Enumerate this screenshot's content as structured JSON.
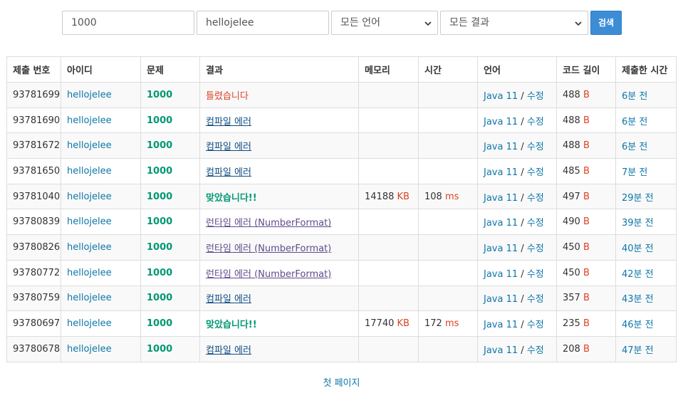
{
  "filters": {
    "problem_id": "1000",
    "user_id": "hellojelee",
    "language": "모든 언어",
    "result": "모든 결과",
    "search_label": "검색"
  },
  "table": {
    "headers": [
      "제출 번호",
      "아이디",
      "문제",
      "결과",
      "메모리",
      "시간",
      "언어",
      "코드 길이",
      "제출한 시간"
    ],
    "rows": [
      {
        "id": "93781699",
        "user": "hellojelee",
        "problem": "1000",
        "result": "틀렸습니다",
        "result_type": "wrong",
        "memory": "",
        "memory_unit": "",
        "time": "",
        "time_unit": "",
        "lang": "Java 11",
        "edit": "수정",
        "code_len": "488",
        "code_unit": "B",
        "submitted": "6분 전"
      },
      {
        "id": "93781690",
        "user": "hellojelee",
        "problem": "1000",
        "result": "컴파일 에러",
        "result_type": "ce",
        "memory": "",
        "memory_unit": "",
        "time": "",
        "time_unit": "",
        "lang": "Java 11",
        "edit": "수정",
        "code_len": "488",
        "code_unit": "B",
        "submitted": "6분 전"
      },
      {
        "id": "93781672",
        "user": "hellojelee",
        "problem": "1000",
        "result": "컴파일 에러",
        "result_type": "ce",
        "memory": "",
        "memory_unit": "",
        "time": "",
        "time_unit": "",
        "lang": "Java 11",
        "edit": "수정",
        "code_len": "488",
        "code_unit": "B",
        "submitted": "6분 전"
      },
      {
        "id": "93781650",
        "user": "hellojelee",
        "problem": "1000",
        "result": "컴파일 에러",
        "result_type": "ce",
        "memory": "",
        "memory_unit": "",
        "time": "",
        "time_unit": "",
        "lang": "Java 11",
        "edit": "수정",
        "code_len": "485",
        "code_unit": "B",
        "submitted": "7분 전"
      },
      {
        "id": "93781040",
        "user": "hellojelee",
        "problem": "1000",
        "result": "맞았습니다!!",
        "result_type": "ac",
        "memory": "14188",
        "memory_unit": "KB",
        "time": "108",
        "time_unit": "ms",
        "lang": "Java 11",
        "edit": "수정",
        "code_len": "497",
        "code_unit": "B",
        "submitted": "29분 전"
      },
      {
        "id": "93780839",
        "user": "hellojelee",
        "problem": "1000",
        "result": "런타임 에러 (NumberFormat)",
        "result_type": "rte",
        "memory": "",
        "memory_unit": "",
        "time": "",
        "time_unit": "",
        "lang": "Java 11",
        "edit": "수정",
        "code_len": "490",
        "code_unit": "B",
        "submitted": "39분 전"
      },
      {
        "id": "93780826",
        "user": "hellojelee",
        "problem": "1000",
        "result": "런타임 에러 (NumberFormat)",
        "result_type": "rte",
        "memory": "",
        "memory_unit": "",
        "time": "",
        "time_unit": "",
        "lang": "Java 11",
        "edit": "수정",
        "code_len": "450",
        "code_unit": "B",
        "submitted": "40분 전"
      },
      {
        "id": "93780772",
        "user": "hellojelee",
        "problem": "1000",
        "result": "런타임 에러 (NumberFormat)",
        "result_type": "rte",
        "memory": "",
        "memory_unit": "",
        "time": "",
        "time_unit": "",
        "lang": "Java 11",
        "edit": "수정",
        "code_len": "450",
        "code_unit": "B",
        "submitted": "42분 전"
      },
      {
        "id": "93780759",
        "user": "hellojelee",
        "problem": "1000",
        "result": "컴파일 에러",
        "result_type": "ce",
        "memory": "",
        "memory_unit": "",
        "time": "",
        "time_unit": "",
        "lang": "Java 11",
        "edit": "수정",
        "code_len": "357",
        "code_unit": "B",
        "submitted": "43분 전"
      },
      {
        "id": "93780697",
        "user": "hellojelee",
        "problem": "1000",
        "result": "맞았습니다!!",
        "result_type": "ac",
        "memory": "17740",
        "memory_unit": "KB",
        "time": "172",
        "time_unit": "ms",
        "lang": "Java 11",
        "edit": "수정",
        "code_len": "235",
        "code_unit": "B",
        "submitted": "46분 전"
      },
      {
        "id": "93780678",
        "user": "hellojelee",
        "problem": "1000",
        "result": "컴파일 에러",
        "result_type": "ce",
        "memory": "",
        "memory_unit": "",
        "time": "",
        "time_unit": "",
        "lang": "Java 11",
        "edit": "수정",
        "code_len": "208",
        "code_unit": "B",
        "submitted": "47분 전"
      }
    ]
  },
  "pagination": {
    "first_page": "첫 페이지"
  },
  "colors": {
    "link": "#0e76a8",
    "accepted": "#009874",
    "wrong": "#dd4124",
    "compile_error": "#0f4c81",
    "runtime_error": "#5f4b8b",
    "search_button": "#3c8dd6"
  },
  "icons": {
    "select_arrow": "chevron-down-icon"
  }
}
